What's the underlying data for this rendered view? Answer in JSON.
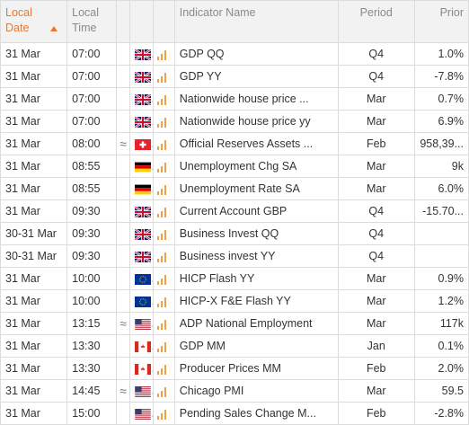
{
  "header": {
    "date": "Local Date",
    "time": "Local Time",
    "indicator": "Indicator Name",
    "period": "Period",
    "prior": "Prior"
  },
  "colors": {
    "accent": "#e9782a",
    "importance": "#f0a040"
  },
  "rows": [
    {
      "date": "31 Mar",
      "time": "07:00",
      "vol": "",
      "flag": "gb",
      "name": "GDP QQ",
      "period": "Q4",
      "prior": "1.0%"
    },
    {
      "date": "31 Mar",
      "time": "07:00",
      "vol": "",
      "flag": "gb",
      "name": "GDP YY",
      "period": "Q4",
      "prior": "-7.8%"
    },
    {
      "date": "31 Mar",
      "time": "07:00",
      "vol": "",
      "flag": "gb",
      "name": "Nationwide house price ...",
      "period": "Mar",
      "prior": "0.7%"
    },
    {
      "date": "31 Mar",
      "time": "07:00",
      "vol": "",
      "flag": "gb",
      "name": "Nationwide house price yy",
      "period": "Mar",
      "prior": "6.9%"
    },
    {
      "date": "31 Mar",
      "time": "08:00",
      "vol": "≈",
      "flag": "ch",
      "name": "Official Reserves Assets ...",
      "period": "Feb",
      "prior": "958,39..."
    },
    {
      "date": "31 Mar",
      "time": "08:55",
      "vol": "",
      "flag": "de",
      "name": "Unemployment Chg SA",
      "period": "Mar",
      "prior": "9k"
    },
    {
      "date": "31 Mar",
      "time": "08:55",
      "vol": "",
      "flag": "de",
      "name": "Unemployment Rate SA",
      "period": "Mar",
      "prior": "6.0%"
    },
    {
      "date": "31 Mar",
      "time": "09:30",
      "vol": "",
      "flag": "gb",
      "name": "Current Account GBP",
      "period": "Q4",
      "prior": "-15.70..."
    },
    {
      "date": "30-31 Mar",
      "time": "09:30",
      "vol": "",
      "flag": "gb",
      "name": "Business Invest QQ",
      "period": "Q4",
      "prior": ""
    },
    {
      "date": "30-31 Mar",
      "time": "09:30",
      "vol": "",
      "flag": "gb",
      "name": "Business invest YY",
      "period": "Q4",
      "prior": ""
    },
    {
      "date": "31 Mar",
      "time": "10:00",
      "vol": "",
      "flag": "eu",
      "name": "HICP Flash YY",
      "period": "Mar",
      "prior": "0.9%"
    },
    {
      "date": "31 Mar",
      "time": "10:00",
      "vol": "",
      "flag": "eu",
      "name": "HICP-X F&E Flash YY",
      "period": "Mar",
      "prior": "1.2%"
    },
    {
      "date": "31 Mar",
      "time": "13:15",
      "vol": "≈",
      "flag": "us",
      "name": "ADP National Employment",
      "period": "Mar",
      "prior": "117k"
    },
    {
      "date": "31 Mar",
      "time": "13:30",
      "vol": "",
      "flag": "ca",
      "name": "GDP MM",
      "period": "Jan",
      "prior": "0.1%"
    },
    {
      "date": "31 Mar",
      "time": "13:30",
      "vol": "",
      "flag": "ca",
      "name": "Producer Prices MM",
      "period": "Feb",
      "prior": "2.0%"
    },
    {
      "date": "31 Mar",
      "time": "14:45",
      "vol": "≈",
      "flag": "us",
      "name": "Chicago PMI",
      "period": "Mar",
      "prior": "59.5"
    },
    {
      "date": "31 Mar",
      "time": "15:00",
      "vol": "",
      "flag": "us",
      "name": "Pending Sales Change M...",
      "period": "Feb",
      "prior": "-2.8%"
    }
  ]
}
